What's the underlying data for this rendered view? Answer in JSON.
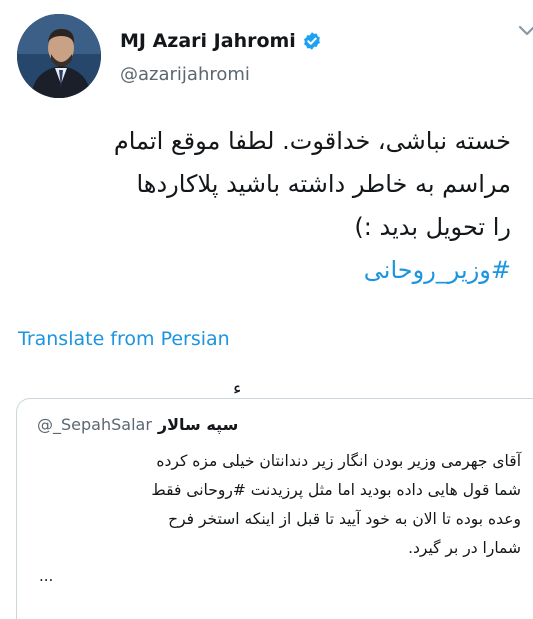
{
  "author": {
    "name": "MJ Azari Jahromi",
    "handle": "@azarijahromi",
    "verified": true,
    "avatar_icon": "profile-photo"
  },
  "tweet": {
    "lines": [
      "خسته نباشی، خداقوت. لطفا موقع اتمام",
      "مراسم به خاطر داشته باشید پلاکاردها",
      "را تحویل بدید :)"
    ],
    "hashtag": "#وزیر_روحانی"
  },
  "translate_link": "Translate from Persian",
  "separator_glyph": "ء",
  "quoted_tweet": {
    "handle": "@_SepahSalar",
    "name": "سپه سالار",
    "lines": [
      "آقای جهرمی وزیر بودن انگار زیر دندانتان خیلی مزه کرده",
      "شما قول هایی داده بودید اما مثل پرزیدنت #روحانی فقط",
      "وعده بوده تا الان به خود آیید تا قبل از اینکه استخر فرح",
      "شمارا در بر گیرد."
    ],
    "ellipsis": "..."
  },
  "colors": {
    "link": "#1b95e0",
    "text": "#14171a",
    "muted": "#5c6770",
    "border": "#ccd6dd"
  }
}
